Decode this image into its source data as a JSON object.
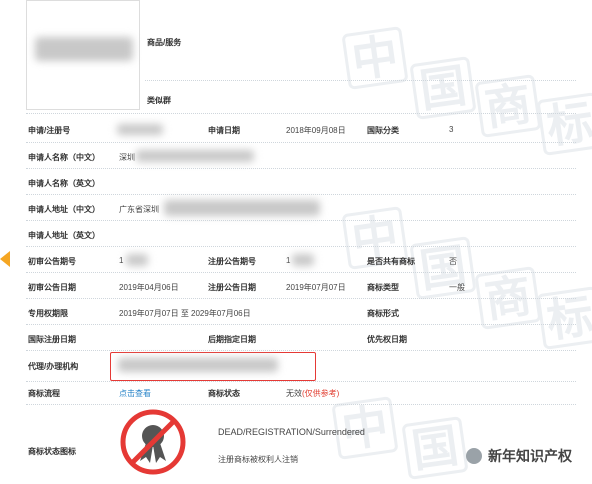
{
  "watermarks": [
    "中",
    "国",
    "商",
    "标"
  ],
  "trademark": {
    "goods_services_label": "商品/服务",
    "similar_group_label": "类似群"
  },
  "fields": {
    "reg_no_label": "申请/注册号",
    "apply_date_label": "申请日期",
    "apply_date": "2018年09月08日",
    "intl_class_label": "国际分类",
    "intl_class": "3",
    "applicant_cn_label": "申请人名称（中文）",
    "applicant_cn": "深圳",
    "applicant_en_label": "申请人名称（英文）",
    "address_cn_label": "申请人地址（中文）",
    "address_cn": "广东省深圳",
    "address_en_label": "申请人地址（英文）",
    "prelim_pub_no_label": "初审公告期号",
    "prelim_pub_no": "1",
    "reg_pub_no_label": "注册公告期号",
    "reg_pub_no": "1",
    "shared_label": "是否共有商标",
    "shared": "否",
    "prelim_pub_date_label": "初审公告日期",
    "prelim_pub_date": "2019年04月06日",
    "reg_pub_date_label": "注册公告日期",
    "reg_pub_date": "2019年07月07日",
    "tm_type_label": "商标类型",
    "tm_type": "一般",
    "exclusive_period_label": "专用权期限",
    "exclusive_period": "2019年07月07日 至 2029年07月06日",
    "tm_form_label": "商标形式",
    "intl_reg_date_label": "国际注册日期",
    "later_designation_label": "后期指定日期",
    "priority_date_label": "优先权日期",
    "agent_label": "代理/办理机构",
    "process_label": "商标流程",
    "process_link": "点击查看",
    "status_label": "商标状态",
    "status_value": "无效",
    "status_note": "(仅供参考)",
    "status_icon_label": "商标状态图标",
    "status_en": "DEAD/REGISTRATION/Surrendered",
    "status_cn": "注册商标被权利人注销"
  },
  "footer": {
    "brand": "新年知识产权"
  }
}
